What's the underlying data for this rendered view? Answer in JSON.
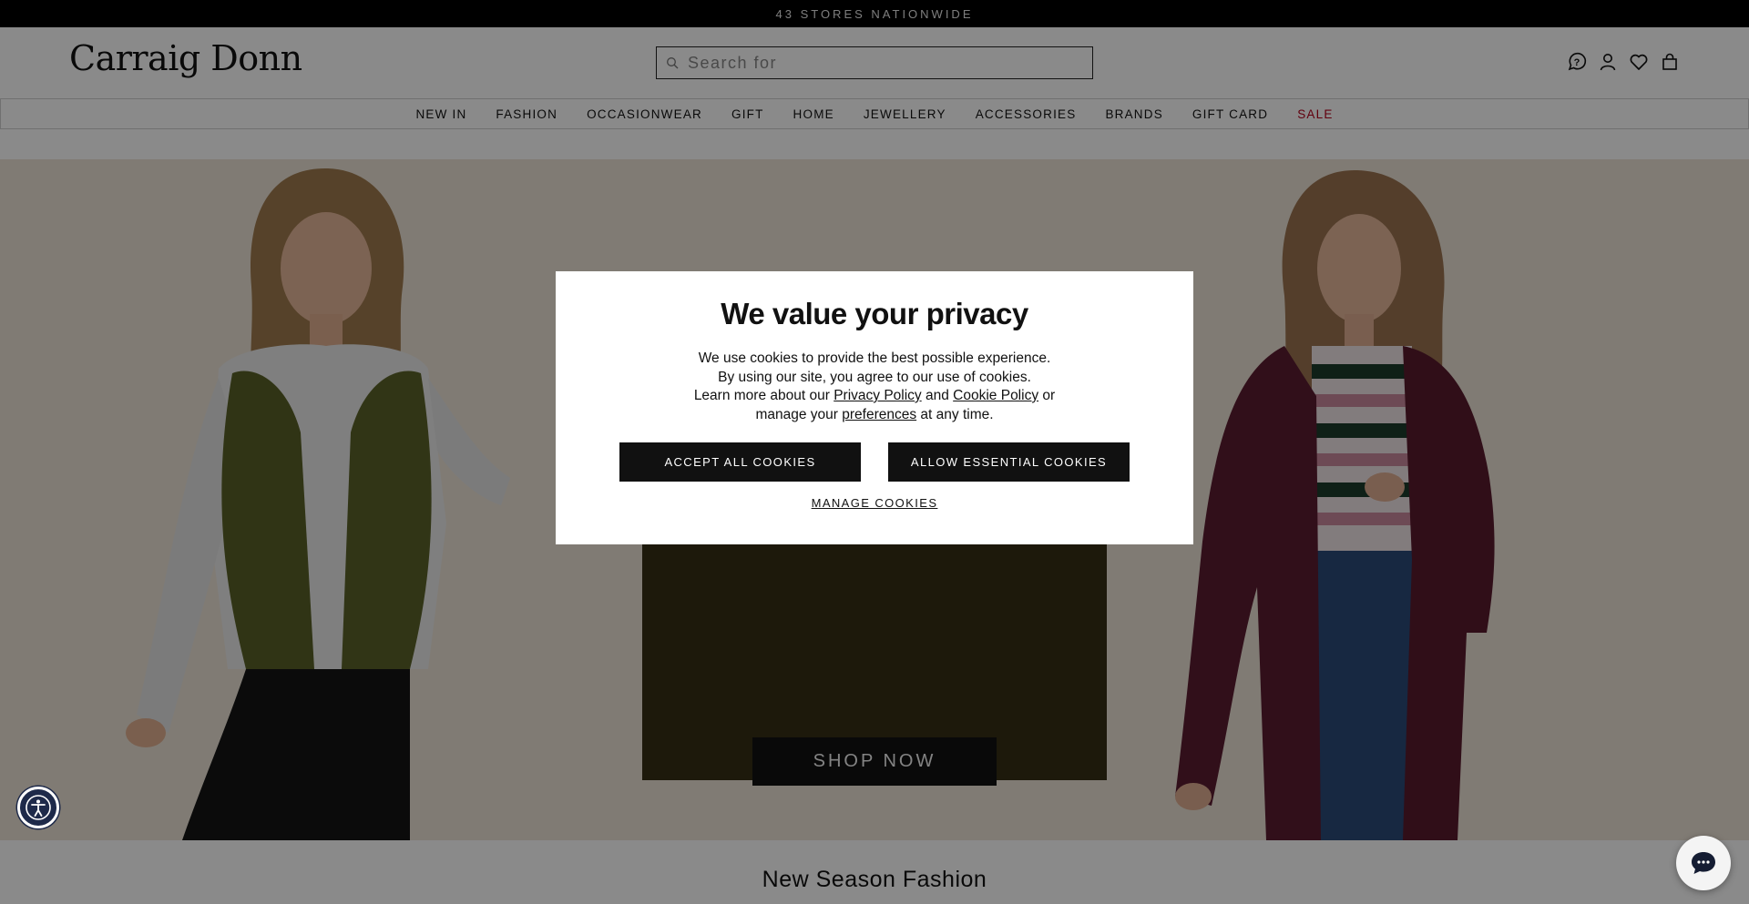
{
  "topbar": {
    "text": "43 STORES NATIONWIDE"
  },
  "header": {
    "logo": "Carraig Donn",
    "search_placeholder": "Search for",
    "icons": [
      "help-icon",
      "account-icon",
      "wishlist-heart-icon",
      "shopping-bag-icon"
    ]
  },
  "nav": {
    "items": [
      "NEW IN",
      "FASHION",
      "OCCASIONWEAR",
      "GIFT",
      "HOME",
      "JEWELLERY",
      "ACCESSORIES",
      "BRANDS",
      "GIFT CARD",
      "SALE"
    ],
    "sale_color": "#b3001b"
  },
  "hero": {
    "cta": "SHOP NOW",
    "left_model": "olive-green-knit-vest-outfit",
    "right_model": "plum-rain-jacket-outfit"
  },
  "section": {
    "title": "New Season Fashion"
  },
  "cookie_modal": {
    "title": "We value your privacy",
    "line1": "We use cookies to provide the best possible experience.",
    "line2": "By using our site, you agree to our use of cookies.",
    "line3_prefix": "Learn more about our",
    "privacy_link": "Privacy Policy",
    "and": "and",
    "cookie_link": "Cookie Policy",
    "or": "or",
    "line4_prefix": "manage your",
    "preferences_link": "preferences",
    "line4_suffix": "at any time.",
    "accept_all": "ACCEPT ALL COOKIES",
    "allow_essential": "ALLOW ESSENTIAL COOKIES",
    "manage": "MANAGE COOKIES"
  },
  "widgets": {
    "accessibility": "accessibility-icon",
    "chat": "chat-bubble-icon"
  },
  "colors": {
    "topbar": "#000000",
    "hero_bg": "#ece4d7",
    "center_block": "#362f15",
    "button": "#111111"
  }
}
